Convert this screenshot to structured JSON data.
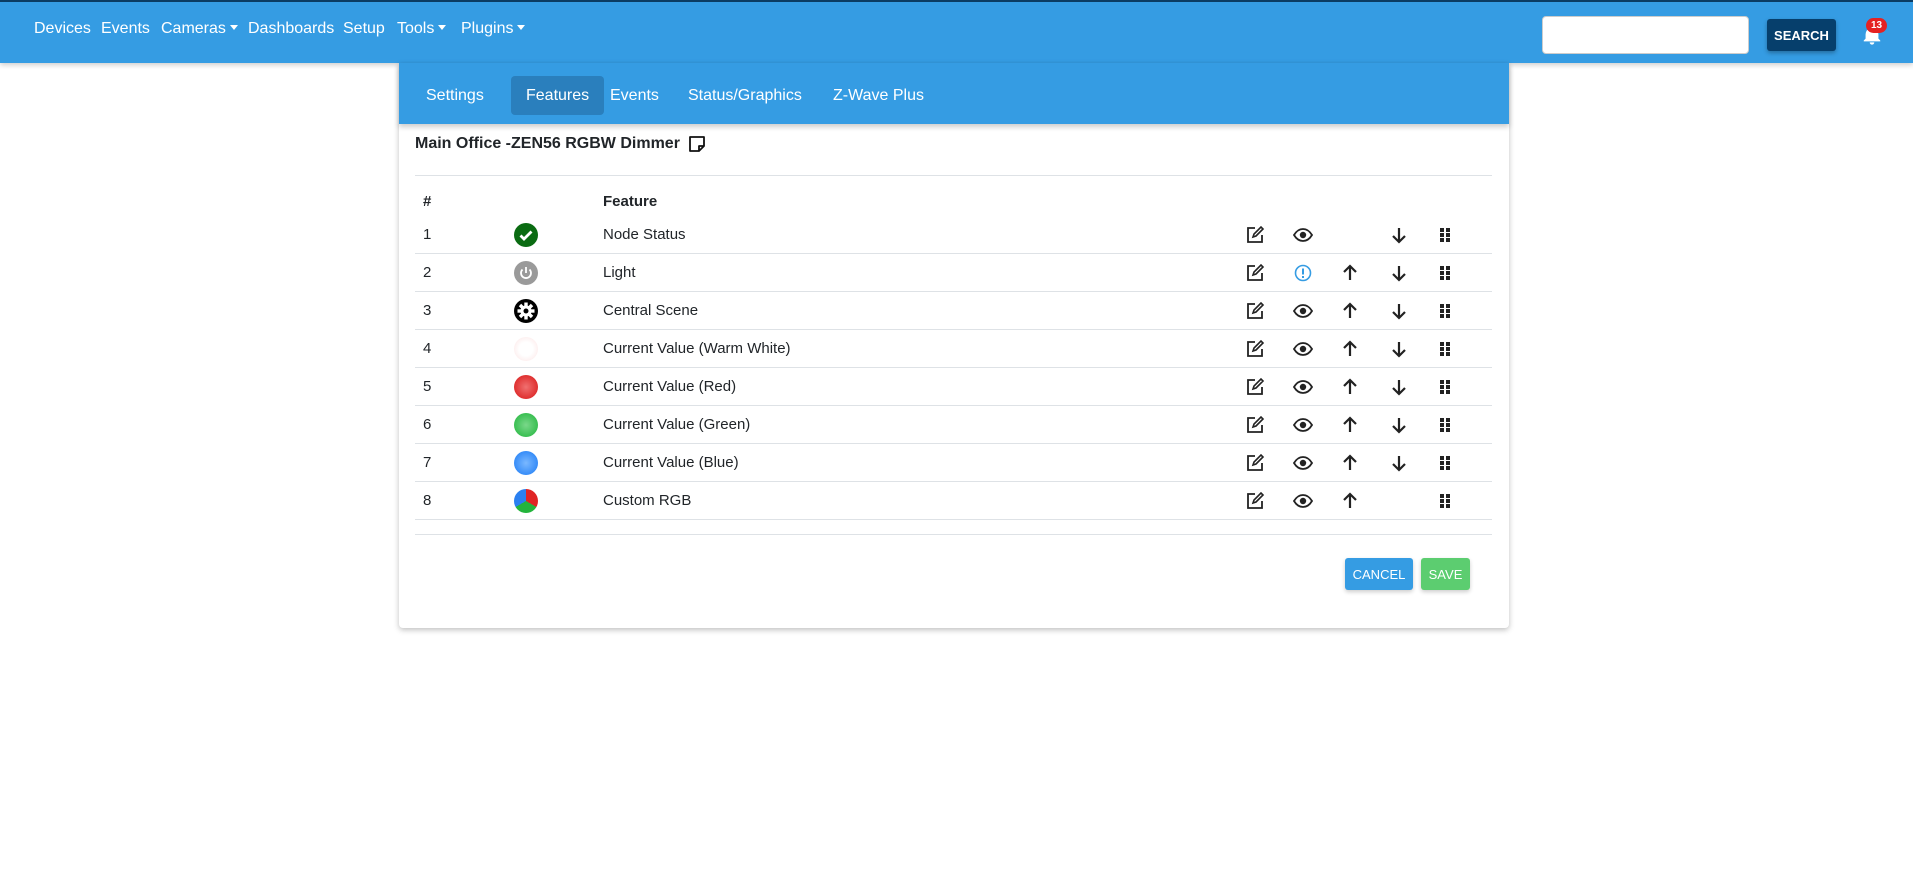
{
  "nav": {
    "items": [
      {
        "label": "Devices",
        "dropdown": false
      },
      {
        "label": "Events",
        "dropdown": false
      },
      {
        "label": "Cameras",
        "dropdown": true
      },
      {
        "label": "Dashboards",
        "dropdown": false
      },
      {
        "label": "Setup",
        "dropdown": false
      },
      {
        "label": "Tools",
        "dropdown": true
      },
      {
        "label": "Plugins",
        "dropdown": true
      }
    ],
    "search_value": "",
    "search_label": "SEARCH",
    "notification_count": "13"
  },
  "tabs": [
    {
      "label": "Settings"
    },
    {
      "label": "Features",
      "active": true
    },
    {
      "label": "Events"
    },
    {
      "label": "Status/Graphics"
    },
    {
      "label": "Z-Wave Plus"
    }
  ],
  "device_title": "Main Office -ZEN56 RGBW Dimmer",
  "table": {
    "headers": {
      "num": "#",
      "feature": "Feature"
    },
    "rows": [
      {
        "num": "1",
        "name": "Node Status",
        "icon": "check-circle-icon",
        "visibility": "eye",
        "up": false,
        "down": true
      },
      {
        "num": "2",
        "name": "Light",
        "icon": "power-icon",
        "visibility": "alert",
        "up": true,
        "down": true
      },
      {
        "num": "3",
        "name": "Central Scene",
        "icon": "gear-icon",
        "visibility": "eye",
        "up": true,
        "down": true
      },
      {
        "num": "4",
        "name": "Current Value (Warm White)",
        "icon": "warm-white-dot-icon",
        "visibility": "eye",
        "up": true,
        "down": true
      },
      {
        "num": "5",
        "name": "Current Value (Red)",
        "icon": "red-dot-icon",
        "visibility": "eye",
        "up": true,
        "down": true
      },
      {
        "num": "6",
        "name": "Current Value (Green)",
        "icon": "green-dot-icon",
        "visibility": "eye",
        "up": true,
        "down": true
      },
      {
        "num": "7",
        "name": "Current Value (Blue)",
        "icon": "blue-dot-icon",
        "visibility": "eye",
        "up": true,
        "down": true
      },
      {
        "num": "8",
        "name": "Custom RGB",
        "icon": "rgb-dot-icon",
        "visibility": "eye",
        "up": true,
        "down": false
      }
    ]
  },
  "buttons": {
    "cancel": "CANCEL",
    "save": "SAVE"
  },
  "colors": {
    "primary": "#359ce3",
    "save": "#5ccd70",
    "search": "#063f6c"
  }
}
